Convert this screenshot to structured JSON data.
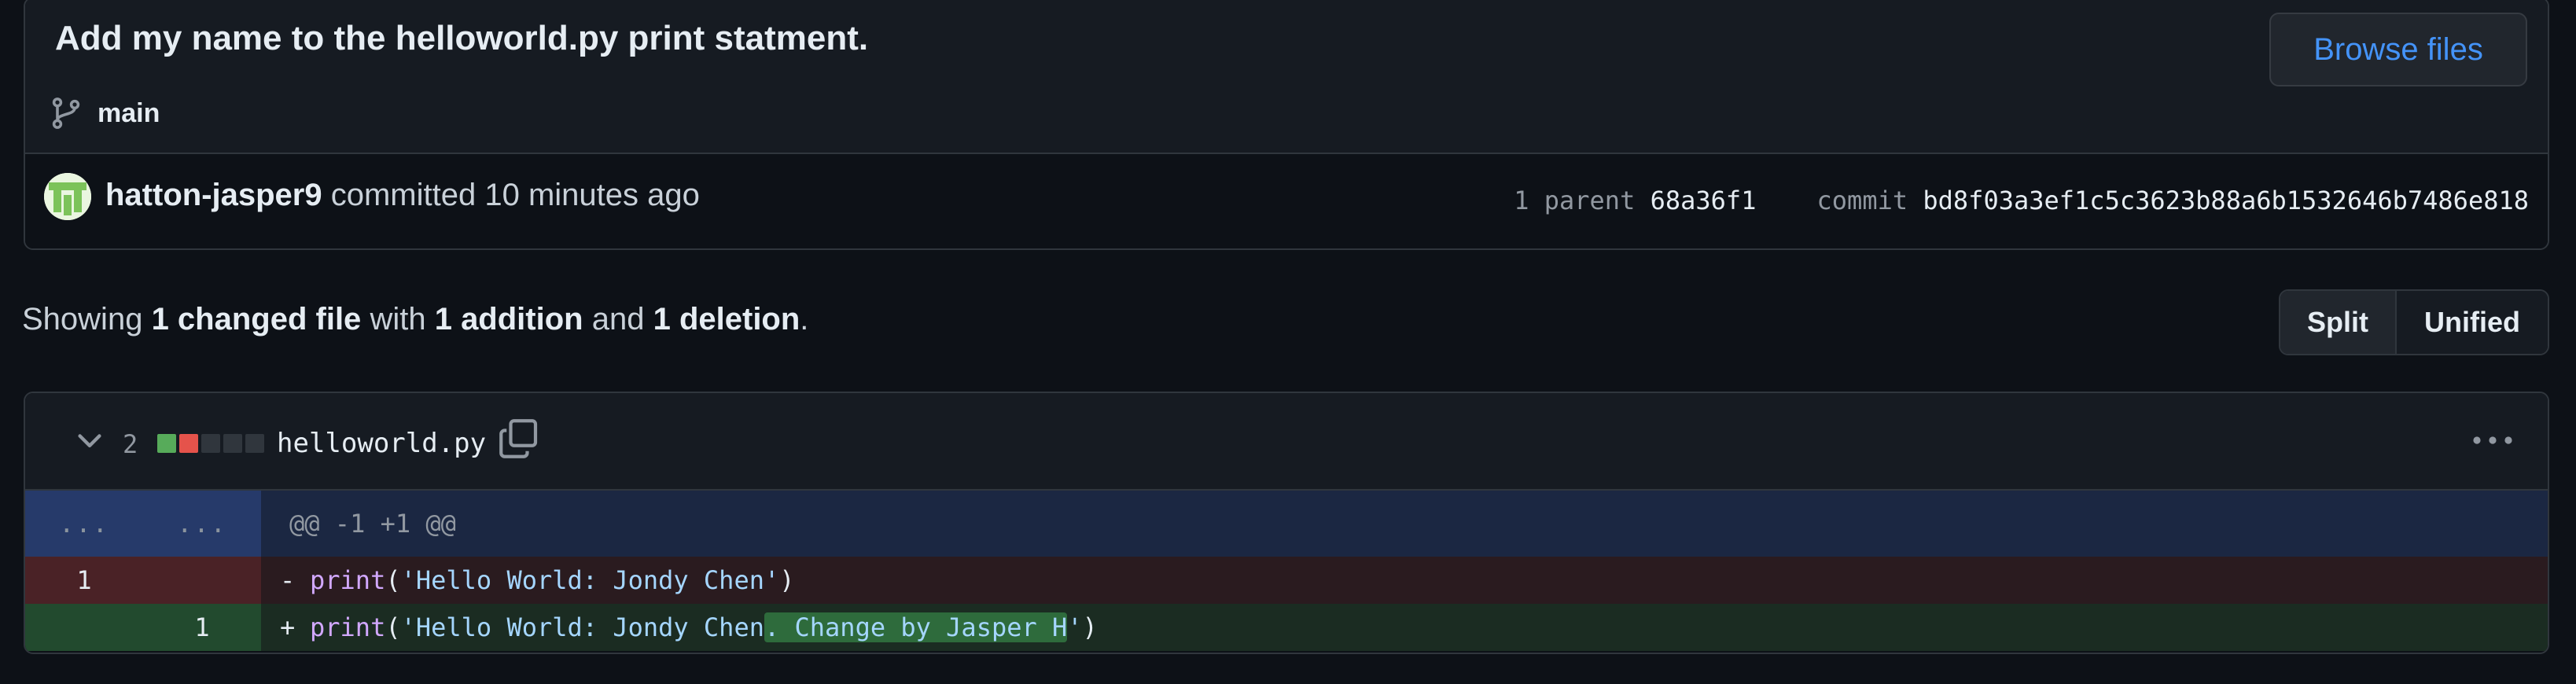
{
  "commit": {
    "title": "Add my name to the helloworld.py print statment.",
    "branch": "main",
    "browse_label": "Browse files",
    "author": "hatton-jasper9",
    "action": "committed",
    "time": "10 minutes ago",
    "parent_label": "1 parent",
    "parent_hash": "68a36f1",
    "commit_label": "commit",
    "commit_hash": "bd8f03a3ef1c5c3623b88a6b1532646b7486e818"
  },
  "summary": {
    "prefix": "Showing",
    "files": "1 changed file",
    "with": "with",
    "additions": "1 addition",
    "and": "and",
    "deletions": "1 deletion",
    "period": "."
  },
  "view_toggle": {
    "split": "Split",
    "unified": "Unified"
  },
  "file": {
    "change_count": "2",
    "name": "helloworld.py",
    "diffstat_colors": [
      "#57ab5a",
      "#e5534b",
      "#30363d",
      "#30363d",
      "#30363d"
    ],
    "hunk": {
      "left_ln": "...",
      "right_ln": "...",
      "header": "@@ -1 +1 @@"
    },
    "deleted": {
      "ln": "1",
      "marker": "-",
      "fn": "print",
      "open": "(",
      "str": "'Hello World: Jondy Chen'",
      "close": ")"
    },
    "added": {
      "ln": "1",
      "marker": "+",
      "fn": "print",
      "open": "(",
      "str_before": "'Hello World: Jondy Chen",
      "str_highlight": ". Change by Jasper H",
      "str_after": "'",
      "close": ")"
    }
  },
  "colors": {
    "accent": "#4493f8",
    "addition": "#57ab5a",
    "deletion": "#e5534b"
  }
}
